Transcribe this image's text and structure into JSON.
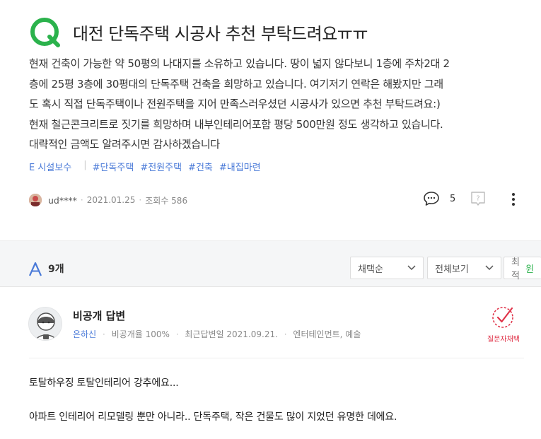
{
  "question": {
    "title": "대전 단독주택 시공사 추천 부탁드려요ㅠㅠ",
    "body_lines": [
      "현재 건축이 가능한 약 50평의 나대지를 소유하고 있습니다. 땅이 넓지 않다보니 1층에 주차2대 2",
      "층에 25평 3층에 30평대의 단독주택 건축을 희망하고 있습니다. 여기저기 연락은 해봤지만 그래",
      "도 혹시 직접 단독주택이나 전원주택을 지어 만족스러우셨던 시공사가 있으면 추천 부탁드려요:)",
      "현재 철근콘크리트로 짓기를 희망하며 내부인테리어포함 평당 500만원 정도 생각하고 있습니다.",
      "대략적인 금액도 알려주시면 감사하겠습니다"
    ],
    "tags": [
      "E 시설보수",
      "#단독주택",
      "#전원주택",
      "#건축",
      "#내집마련"
    ],
    "author": "ud****",
    "date": "2021.01.25",
    "views": "조회수 586",
    "comment_count": "5"
  },
  "answers_bar": {
    "count": "9개",
    "sort_label": "채택순",
    "view_label": "전체보기",
    "latest_label": "최적",
    "latest_extra": "윈"
  },
  "answer": {
    "name": "비공개 답변",
    "profile_link": "은하신",
    "adopt_rate": "비공개율 100%",
    "recent": "최근답변일 2021.09.21.",
    "category": "엔터테인먼트, 예술",
    "pick_label": "질문자채택",
    "body": [
      "토탈하우징 토탈인테리어 강추에요...",
      "아파트 인테리어 리모델링 뿐만 아니라.. 단독주택, 작은 건물도 많이 지었던 유명한 데에요."
    ]
  },
  "colors": {
    "brand_green": "#2bb24c",
    "link_blue": "#4a7ad8",
    "pick_red": "#e0344a"
  }
}
